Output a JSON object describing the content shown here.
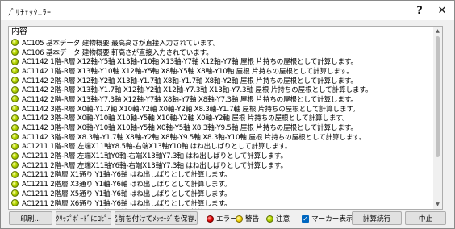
{
  "window": {
    "title": "ﾌﾟﾘﾁｪｯｸｴﾗｰ",
    "help": "?",
    "close": "✕"
  },
  "list": {
    "header": "内容",
    "rows": [
      "AC105 基本データ 建物概要 最高高さが直接入力されています。",
      "AC106 基本データ 建物概要 軒高さが直接入力されています。",
      "AC1142 1階-R層 X12軸-Y5軸 X13軸-Y10軸 X13軸-Y7軸 X12軸-Y7軸 屋根 片持ちの屋根として計算します。",
      "AC1142 1階-R層 X13軸-Y10軸 X12軸-Y5軸 X8軸-Y5軸 X8軸-Y10軸 屋根 片持ちの屋根として計算します。",
      "AC1142 2階-R層 X12軸-Y2軸 X13軸-Y1.7軸 X8軸-Y1.7軸 X8軸-Y2軸 屋根 片持ちの屋根として計算します。",
      "AC1142 2階-R層 X13軸-Y1.7軸 X12軸-Y2軸 X12軸-Y7.3軸 X13軸-Y7.3軸 屋根 片持ちの屋根として計算します。",
      "AC1142 2階-R層 X13軸-Y7.3軸 X12軸-Y7軸 X8軸-Y7軸 X8軸-Y7.3軸 屋根 片持ちの屋根として計算します。",
      "AC1142 3階-R層 X0軸-Y1.7軸 X10軸-Y2軸 X0軸-Y2軸 X8.3軸-Y1.7軸 屋根 片持ちの屋根として計算します。",
      "AC1142 3階-R層 X0軸-Y10軸 X10軸-Y5軸 X10軸-Y2軸 X0軸-Y2軸 屋根 片持ちの屋根として計算します。",
      "AC1142 3階-R層 X0軸-Y10軸 X10軸-Y5軸 X0軸-Y5軸 X8.3軸-Y9.5軸 屋根 片持ちの屋根として計算します。",
      "AC1142 3階-R層 X8.3軸-Y1.7軸 X8軸-Y2軸 X8軸-Y9.5軸 X8.3軸-Y10軸 屋根 片持ちの屋根として計算します。",
      "AC1211 1階-R層 左端X11軸Y8.5軸-右端X13軸Y10軸 はね出しばりとして計算します。",
      "AC1211 2階-R層 左端X11軸Y0軸-右端X13軸Y7.3軸 はね出しばりとして計算します。",
      "AC1211 2階-R層 左端X11軸Y6軸-右端X13軸Y7.3軸 はね出しばりとして計算します。",
      "AC1211 2階層 X1通り Y1軸-Y6軸 はね出しばりとして計算します。",
      "AC1211 2階層 X3通り Y1軸-Y6軸 はね出しばりとして計算します。",
      "AC1211 2階層 X5通り Y1軸-Y6軸 はね出しばりとして計算します。",
      "AC1211 2階層 X6通り Y1軸-Y6軸 はね出しばりとして計算します。",
      "AC1211 2階層 X8通り Y1軸-Y6軸 はね出しばりとして計算します。",
      "AC1211 3階-R層 左端X0軸Y1.7軸-右端X2軸Y3軸 はね出しばりとして計算します。"
    ]
  },
  "footer": {
    "print": "印刷...",
    "copy": "ｸﾘｯﾌﾟﾎﾞｰﾄﾞにｺﾋﾟｰ",
    "save": "名前を付けてﾒｯｾｰｼﾞを保存...",
    "error": "エラー",
    "warning": "警告",
    "notice": "注意",
    "marker": "マーカー表示",
    "recalc": "計算続行",
    "stop": "中止"
  },
  "colors": {
    "error": "#e00000",
    "warning": "#f1d200",
    "notice": "#b8d800",
    "checkbox": "#0067c0"
  },
  "icons": {
    "row_status": "notice-dot-icon",
    "marker_checked": true
  }
}
